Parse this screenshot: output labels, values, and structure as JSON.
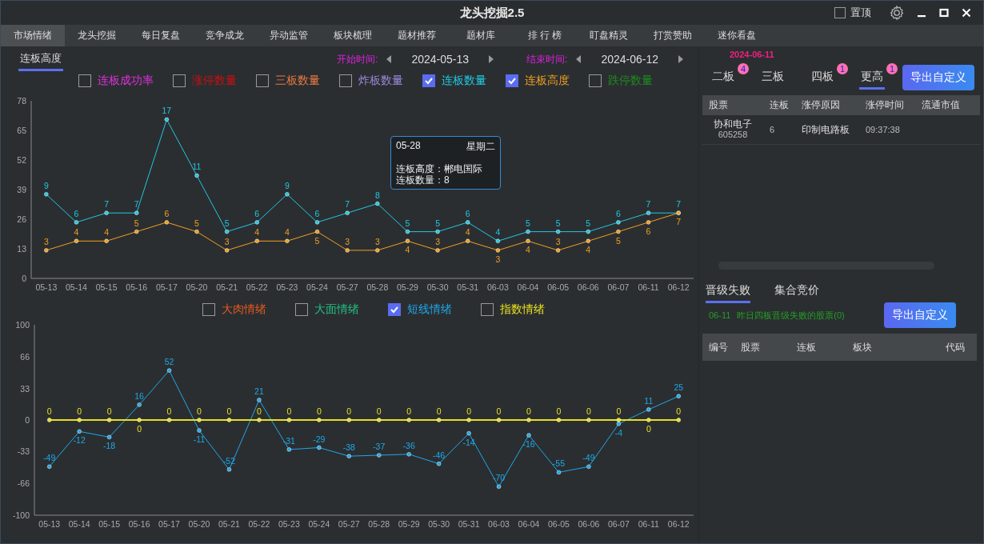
{
  "window": {
    "title": "龙头挖掘2.5",
    "pin": {
      "label": "置顶",
      "checked": false
    }
  },
  "tabs": [
    {
      "label": "市场情绪",
      "selected": true
    },
    {
      "label": "龙头挖掘",
      "selected": false
    },
    {
      "label": "每日复盘",
      "selected": false
    },
    {
      "label": "竞争成龙",
      "selected": false
    },
    {
      "label": "异动监管",
      "selected": false
    },
    {
      "label": "板块梳理",
      "selected": false
    },
    {
      "label": "题材推荐",
      "selected": false
    },
    {
      "label": "题材库",
      "selected": false
    },
    {
      "label": "排 行 榜",
      "selected": false
    },
    {
      "label": "盯盘精灵",
      "selected": false
    },
    {
      "label": "打赏赞助",
      "selected": false
    },
    {
      "label": "迷你看盘",
      "selected": false
    }
  ],
  "market": {
    "subtabs": [
      {
        "label": "连板高度",
        "selected": true
      }
    ],
    "start": {
      "label": "开始时间:",
      "value": "2024-05-13"
    },
    "end": {
      "label": "结束时间:",
      "value": "2024-06-12"
    }
  },
  "charts": [
    {
      "legend": [
        {
          "label": "连板成功率",
          "checked": false,
          "color": "#e030e0"
        },
        {
          "label": "涨停数量",
          "checked": false,
          "color": "#c81010"
        },
        {
          "label": "三板数量",
          "checked": false,
          "color": "#e87840"
        },
        {
          "label": "炸板数量",
          "checked": false,
          "color": "#9a88d8"
        },
        {
          "kind": "series",
          "checked": true
        },
        {
          "kind": "series",
          "checked": true
        },
        {
          "label": "跌停数量",
          "checked": false,
          "color": "#1e8a1e"
        }
      ],
      "chart_data": {
        "type": "line",
        "categories": [
          "05-13",
          "05-14",
          "05-15",
          "05-16",
          "05-17",
          "05-20",
          "05-21",
          "05-22",
          "05-23",
          "05-24",
          "05-27",
          "05-28",
          "05-29",
          "05-30",
          "05-31",
          "06-03",
          "06-04",
          "06-05",
          "06-06",
          "06-07",
          "06-11",
          "06-12"
        ],
        "ylim": [
          0,
          19
        ],
        "data_labels": true,
        "series": [
          {
            "name": "连板数量",
            "color": "#20c8e0",
            "marker": "circle",
            "values": [
              9,
              6,
              7,
              7,
              17,
              11,
              5,
              6,
              9,
              6,
              7,
              8,
              5,
              5,
              6,
              4,
              5,
              5,
              5,
              6,
              7,
              7
            ]
          },
          {
            "name": "连板高度",
            "color": "#f0a020",
            "marker": "circle",
            "values": [
              3,
              4,
              4,
              5,
              6,
              5,
              3,
              4,
              4,
              5,
              3,
              3,
              4,
              3,
              4,
              3,
              4,
              3,
              4,
              5,
              6,
              7
            ]
          }
        ]
      },
      "y_axis_labels": [
        "78",
        "65",
        "52",
        "39",
        "26",
        "13",
        "0"
      ],
      "tooltip": {
        "date": "05-28",
        "weekday": "星期二",
        "lines": [
          "连板高度：郴电国际",
          "连板数量：8"
        ]
      }
    },
    {
      "legend": [
        {
          "label": "大肉情绪",
          "checked": false,
          "color": "#e85a20"
        },
        {
          "label": "大面情绪",
          "checked": false,
          "color": "#20c080"
        },
        {
          "kind": "series",
          "checked": true
        },
        {
          "kind": "series",
          "checked": false
        }
      ],
      "chart_data": {
        "type": "line",
        "categories": [
          "05-13",
          "05-14",
          "05-15",
          "05-16",
          "05-17",
          "05-20",
          "05-21",
          "05-22",
          "05-23",
          "05-24",
          "05-27",
          "05-28",
          "05-29",
          "05-30",
          "05-31",
          "06-03",
          "06-04",
          "06-05",
          "06-06",
          "06-07",
          "06-11",
          "06-12"
        ],
        "ylim": [
          -100,
          100
        ],
        "yticks": [
          -100,
          -66,
          -33,
          0,
          33,
          66,
          100
        ],
        "data_labels": true,
        "series": [
          {
            "name": "短线情绪",
            "color": "#1ea8e8",
            "marker": "circle",
            "values": [
              -49,
              -12,
              -18,
              16,
              52,
              -11,
              -52,
              21,
              -31,
              -29,
              -38,
              -37,
              -36,
              -46,
              -14,
              -70,
              -16,
              -55,
              -49,
              -4,
              11,
              25
            ]
          },
          {
            "name": "指数情绪",
            "color": "#e8e020",
            "marker": "circle",
            "values": [
              0,
              0,
              0,
              0,
              0,
              0,
              0,
              0,
              0,
              0,
              0,
              0,
              0,
              0,
              0,
              0,
              0,
              0,
              0,
              0,
              0,
              0
            ]
          }
        ]
      }
    }
  ],
  "ladder": {
    "date": "2024-06-11",
    "tabs": [
      {
        "label": "二板",
        "badge": "4",
        "selected": false
      },
      {
        "label": "三板",
        "selected": false
      },
      {
        "label": "四板",
        "badge": "1",
        "selected": false
      },
      {
        "label": "更高",
        "badge": "1",
        "selected": true
      }
    ],
    "export_button": "导出自定义",
    "columns": [
      "股票",
      "连板",
      "涨停原因",
      "涨停时间",
      "流通市值"
    ],
    "rows": [
      {
        "name": "协和电子",
        "code": "605258",
        "boards": "6",
        "reason": "印制电路板",
        "time": "09:37:38"
      }
    ]
  },
  "failed": {
    "tabs": [
      {
        "label": "晋级失败",
        "selected": true
      },
      {
        "label": "集合竞价",
        "selected": false
      }
    ],
    "note_date": "06-11",
    "note": "昨日四板晋级失败的股票(0)",
    "export_button": "导出自定义",
    "columns": [
      "编号",
      "股票",
      "连板",
      "板块",
      "代码"
    ]
  }
}
